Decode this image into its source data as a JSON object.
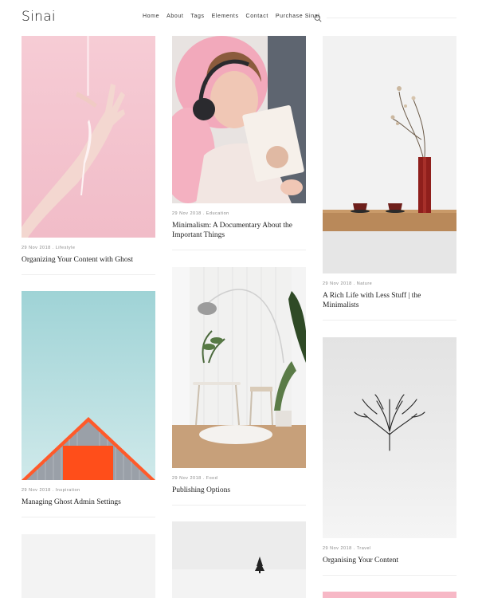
{
  "site": {
    "title": "Sinai"
  },
  "nav": {
    "items": [
      {
        "label": "Home"
      },
      {
        "label": "About"
      },
      {
        "label": "Tags"
      },
      {
        "label": "Elements"
      },
      {
        "label": "Contact"
      },
      {
        "label": "Purchase Sinai"
      }
    ]
  },
  "posts": [
    {
      "date": "29 Nov 2018",
      "tag": "Lifestyle",
      "title": "Organizing Your Content with Ghost",
      "image_icon": "pink-hand-image"
    },
    {
      "date": "29 Nov 2018",
      "tag": "Inspiration",
      "title": "Managing Ghost Admin Settings",
      "image_icon": "red-roof-image"
    },
    {
      "date": "29 Nov 2018",
      "tag": "Education",
      "title": "Minimalism: A Documentary About the Important Things",
      "image_icon": "headphones-reader-image"
    },
    {
      "date": "29 Nov 2018",
      "tag": "Food",
      "title": "Publishing Options",
      "image_icon": "white-interior-image"
    },
    {
      "date": "29 Nov 2018",
      "tag": "Nature",
      "title": "A Rich Life with Less Stuff | the Minimalists",
      "image_icon": "vase-teacups-image"
    },
    {
      "date": "29 Nov 2018",
      "tag": "Travel",
      "title": "Organising Your Content",
      "image_icon": "lone-tree-image"
    }
  ],
  "colors": {
    "pink_bg": "#f4c6cf",
    "sky_bg": "#a8d7da",
    "roof_red": "#ff4e1a",
    "accent_pink": "#f7b8c6"
  }
}
